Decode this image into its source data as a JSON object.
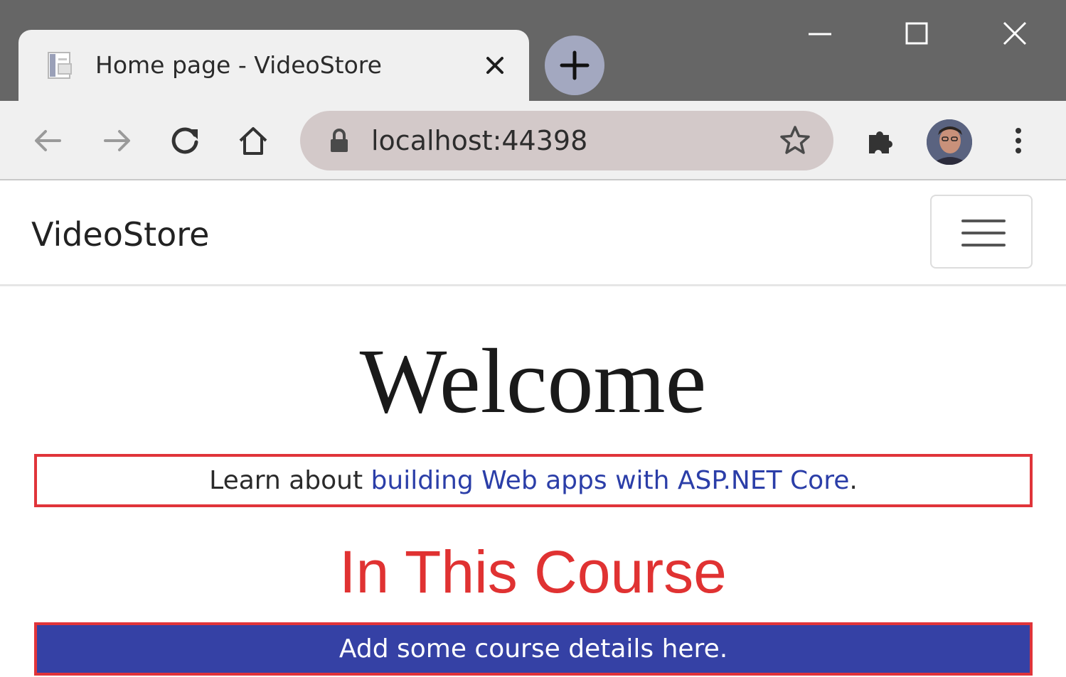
{
  "browser": {
    "tab": {
      "title": "Home page - VideoStore",
      "favicon": "document-icon"
    },
    "address_bar": {
      "url": "localhost:44398"
    },
    "icons": [
      "back-arrow-icon",
      "forward-arrow-icon",
      "reload-icon",
      "home-icon",
      "lock-icon",
      "star-icon",
      "extensions-puzzle-icon",
      "profile-avatar",
      "more-menu-icon",
      "minimize-icon",
      "maximize-icon",
      "close-icon",
      "plus-icon"
    ]
  },
  "navbar": {
    "brand": "VideoStore",
    "toggler_icon": "hamburger-icon"
  },
  "main": {
    "heading": "Welcome",
    "learn_prefix": "Learn about ",
    "learn_link": "building Web apps with ASP.NET Core",
    "learn_suffix": ".",
    "course_heading": "In This Course",
    "course_details": "Add some course details here."
  },
  "colors": {
    "titlebar": "#666666",
    "chrome": "#f0f0f0",
    "omnibox": "#d3c9c9",
    "link": "#2b3ea8",
    "accent_red": "#e03232",
    "details_bg": "#3541a5"
  }
}
